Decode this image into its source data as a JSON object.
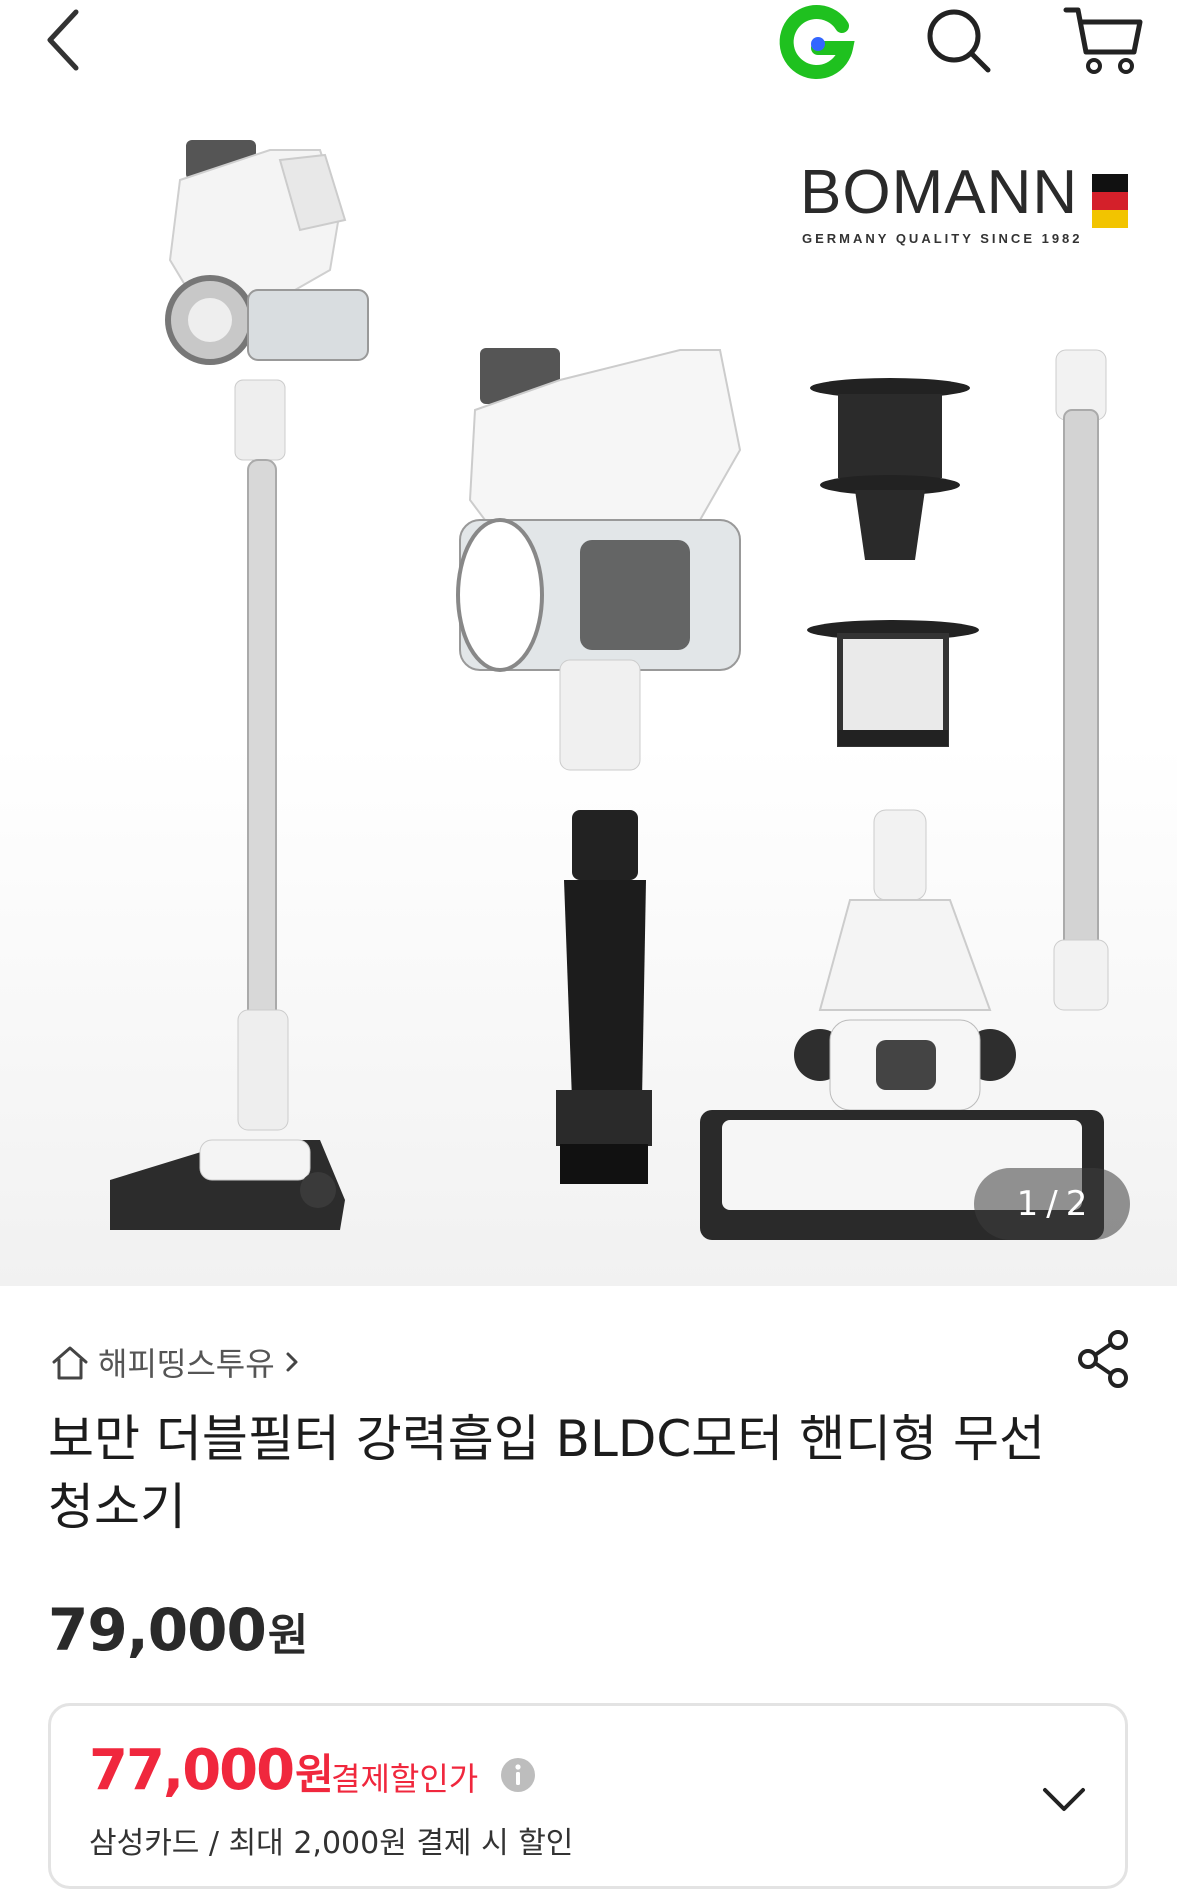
{
  "header": {
    "back_icon": "chevron-left-icon",
    "brand_icon": "g-logo-icon",
    "search_icon": "search-icon",
    "cart_icon": "cart-icon",
    "g_logo_colors": {
      "outer": "#1fc11f",
      "dot": "#3366ff"
    }
  },
  "gallery": {
    "brand_name": "BOMANN",
    "brand_tagline": "GERMANY QUALITY SINCE 1982",
    "pager_current": "1",
    "pager_separator": "/",
    "pager_total": "2"
  },
  "seller": {
    "home_icon": "home-icon",
    "name": "해피띵스투유",
    "chevron_icon": "chevron-right-icon",
    "share_icon": "share-icon"
  },
  "product": {
    "title": "보만 더블필터 강력흡입 BLDC모터 핸디형 무선청소기",
    "price_value": "79,000",
    "price_unit": "원"
  },
  "discount": {
    "price_value": "77,000",
    "price_unit": "원",
    "label": "결제할인가",
    "info_icon": "info-icon",
    "card_info": "삼성카드 / 최대 2,000원 결제 시 할인",
    "expand_icon": "chevron-down-icon",
    "accent_color": "#f0273d"
  }
}
